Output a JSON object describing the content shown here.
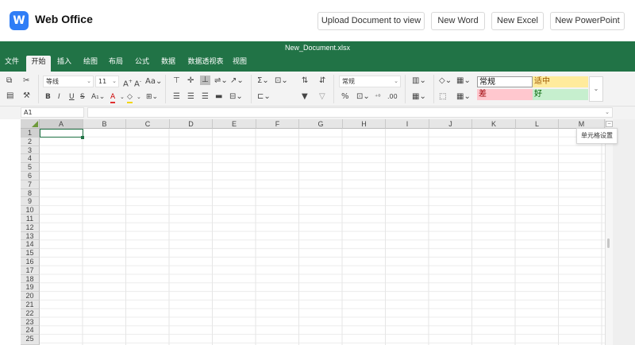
{
  "app": {
    "logo_letter": "W",
    "title": "Web Office",
    "buttons": {
      "upload": "Upload Document to view",
      "new_word": "New Word",
      "new_excel": "New Excel",
      "new_powerpoint": "New PowerPoint"
    }
  },
  "document": {
    "filename": "New_Document.xlsx"
  },
  "tabs": [
    {
      "label": "文件",
      "active": false
    },
    {
      "label": "开始",
      "active": true
    },
    {
      "label": "插入",
      "active": false
    },
    {
      "label": "绘图",
      "active": false
    },
    {
      "label": "布局",
      "active": false
    },
    {
      "label": "公式",
      "active": false
    },
    {
      "label": "数据",
      "active": false
    },
    {
      "label": "数据透视表",
      "active": false
    },
    {
      "label": "视图",
      "active": false
    }
  ],
  "ribbon": {
    "font_name": "等线",
    "font_size": "11",
    "number_format": "常规",
    "cell_styles": {
      "normal": "常规",
      "neutral": "适中",
      "bad": "差",
      "good": "好"
    },
    "style_colors": {
      "neutral_bg": "#ffeb9c",
      "neutral_fg": "#9c5700",
      "bad_bg": "#ffc7ce",
      "bad_fg": "#9c0006",
      "good_bg": "#c6efce",
      "good_fg": "#006100"
    },
    "icons": [
      "copy-icon",
      "cut-icon",
      "paste-icon",
      "format-painter-icon",
      "bold-icon",
      "italic-icon",
      "underline-icon",
      "strikethrough-icon",
      "font-color-icon",
      "fill-color-icon",
      "border-icon",
      "align-top-icon",
      "align-middle-icon",
      "align-bottom-icon",
      "wrap-text-icon",
      "align-left-icon",
      "align-center-icon",
      "align-right-icon",
      "justify-icon",
      "merge-icon",
      "sum-icon",
      "clear-icon",
      "sort-asc-icon",
      "sort-desc-icon",
      "filter-icon",
      "clear-filter-icon",
      "percent-icon",
      "currency-icon",
      "decimal-icon",
      "insert-icon",
      "delete-icon",
      "format-icon",
      "conditional-format-icon",
      "table-format-icon"
    ]
  },
  "formula_bar": {
    "cell_ref": "A1",
    "value": ""
  },
  "grid": {
    "columns": [
      "A",
      "B",
      "C",
      "D",
      "E",
      "F",
      "G",
      "H",
      "I",
      "J",
      "K",
      "L",
      "M"
    ],
    "rows": [
      "1",
      "2",
      "3",
      "4",
      "5",
      "6",
      "7",
      "8",
      "9",
      "10",
      "11",
      "12",
      "13",
      "14",
      "15",
      "16",
      "17",
      "18",
      "19",
      "20",
      "21",
      "22",
      "23",
      "24",
      "25"
    ],
    "selected_column": "A",
    "selected_row": "1"
  },
  "tooltip": {
    "text": "单元格设置"
  },
  "colors": {
    "brand_green": "#217346",
    "logo_blue": "#2f7df6"
  }
}
